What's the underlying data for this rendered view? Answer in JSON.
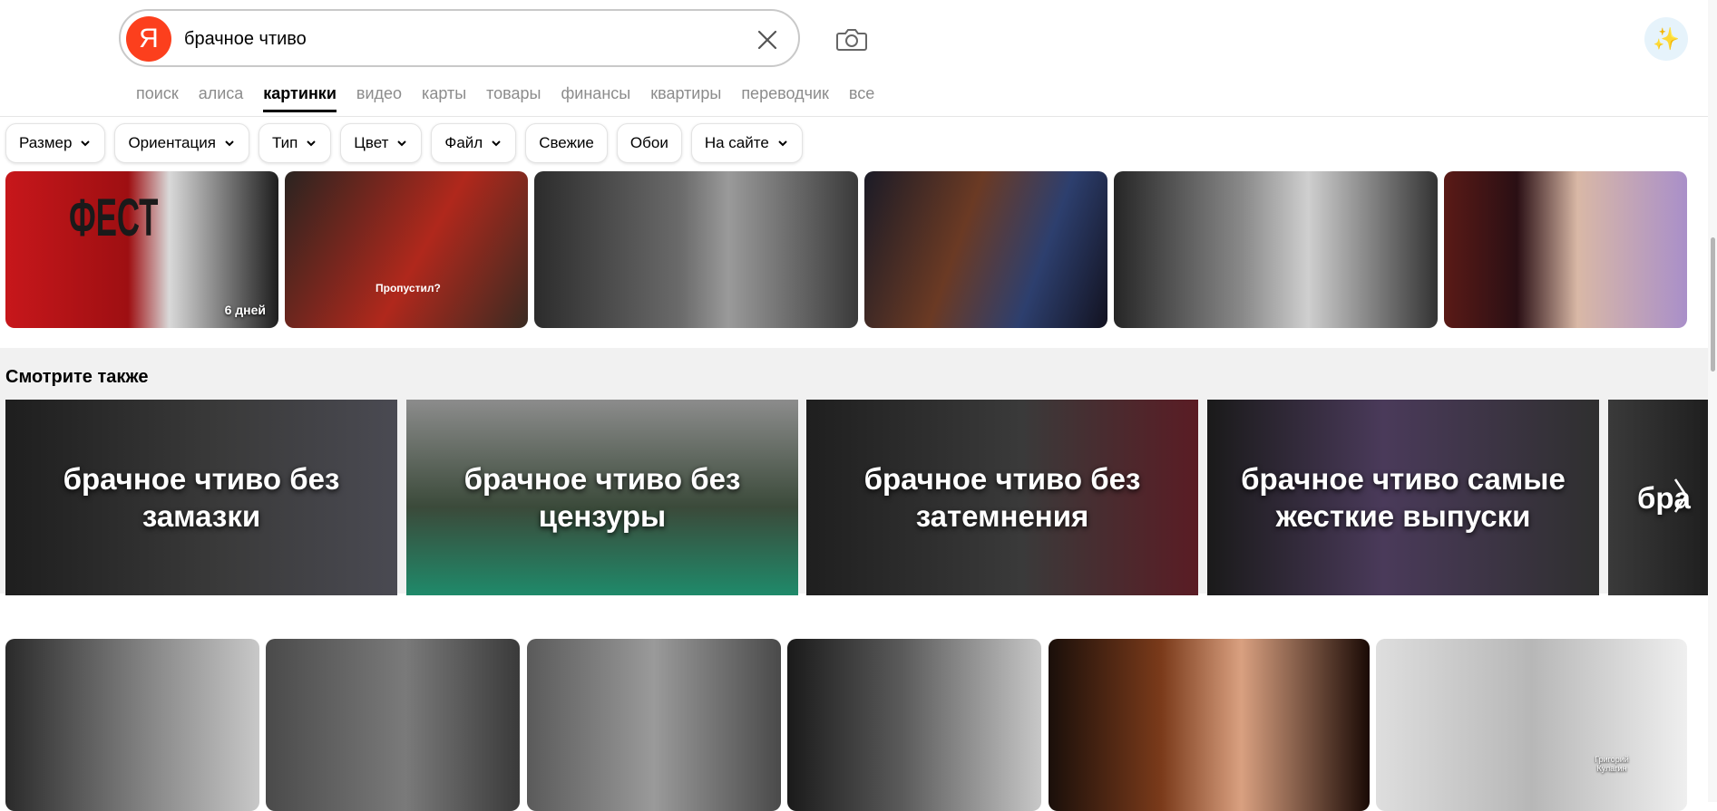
{
  "search": {
    "logo_letter": "Я",
    "query": "брачное чтиво"
  },
  "icons": {
    "clear": "close-icon",
    "camera": "camera-icon",
    "assistant": "sparkle-icon",
    "next": "chevron-right-icon"
  },
  "tabs": [
    {
      "label": "поиск",
      "active": false
    },
    {
      "label": "алиса",
      "active": false
    },
    {
      "label": "картинки",
      "active": true
    },
    {
      "label": "видео",
      "active": false
    },
    {
      "label": "карты",
      "active": false
    },
    {
      "label": "товары",
      "active": false
    },
    {
      "label": "финансы",
      "active": false
    },
    {
      "label": "квартиры",
      "active": false
    },
    {
      "label": "переводчик",
      "active": false
    },
    {
      "label": "все",
      "active": false
    }
  ],
  "filters": [
    {
      "label": "Размер",
      "dropdown": true
    },
    {
      "label": "Ориентация",
      "dropdown": true
    },
    {
      "label": "Тип",
      "dropdown": true
    },
    {
      "label": "Цвет",
      "dropdown": true
    },
    {
      "label": "Файл",
      "dropdown": true
    },
    {
      "label": "Свежие",
      "dropdown": false
    },
    {
      "label": "Обои",
      "dropdown": false
    },
    {
      "label": "На сайте",
      "dropdown": true
    }
  ],
  "results_top": [
    {
      "badge": "6 дней",
      "caption": "ФЕСТ"
    },
    {
      "badge": "",
      "caption": "Пропустил?"
    },
    {
      "badge": "",
      "caption": ""
    },
    {
      "badge": "",
      "caption": ""
    },
    {
      "badge": "",
      "caption": ""
    },
    {
      "badge": "",
      "caption": ""
    }
  ],
  "see_also": {
    "title": "Смотрите также",
    "items": [
      {
        "label": "брачное чтиво без замазки"
      },
      {
        "label": "брачное чтиво без цензуры"
      },
      {
        "label": "брачное чтиво без затемнения"
      },
      {
        "label": "брачное чтиво самые жесткие выпуски"
      },
      {
        "label": "бра"
      }
    ]
  },
  "results_bottom": [
    {
      "caption": ""
    },
    {
      "caption": ""
    },
    {
      "caption": ""
    },
    {
      "caption": ""
    },
    {
      "caption": ""
    },
    {
      "caption": "Григорий Кулагин"
    }
  ],
  "colors": {
    "logo": "#fc3f1d",
    "tab_active": "#000000",
    "tab_inactive": "#8c8c8c",
    "see_also_bg": "#f1f1f1"
  }
}
